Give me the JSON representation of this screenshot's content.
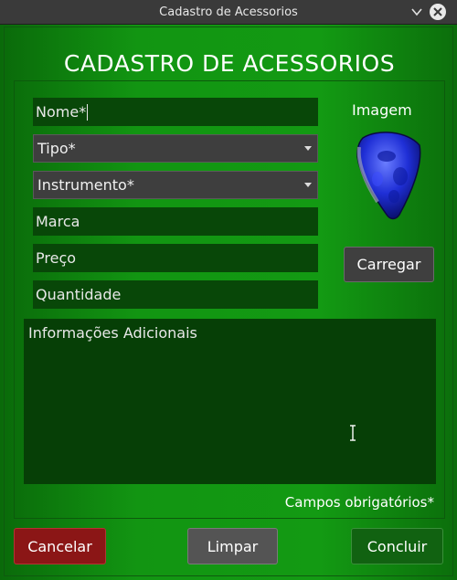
{
  "window": {
    "title": "Cadastro de Acessorios",
    "minimize_icon": "chevron-down-icon",
    "close_icon": "close-icon"
  },
  "form": {
    "heading": "CADASTRO DE ACESSORIOS",
    "name": {
      "placeholder": "Nome*",
      "value": ""
    },
    "type": {
      "selected": "Tipo*"
    },
    "instrument": {
      "selected": "Instrumento*"
    },
    "brand": {
      "placeholder": "Marca",
      "value": ""
    },
    "price": {
      "placeholder": "Preço",
      "value": ""
    },
    "quantity": {
      "placeholder": "Quantidade",
      "value": ""
    },
    "additional_info": {
      "placeholder": "Informações Adicionais",
      "value": ""
    },
    "image_label": "Imagem",
    "image_icon": "guitar-pick-icon",
    "load_button": "Carregar",
    "required_note": "Campos obrigatórios*"
  },
  "actions": {
    "cancel": "Cancelar",
    "clear": "Limpar",
    "confirm": "Concluir"
  },
  "colors": {
    "background_green": "#139a13",
    "field_dark_green": "#084708",
    "cancel_red": "#8b1616",
    "clear_gray": "#545454",
    "confirm_green": "#116211"
  }
}
